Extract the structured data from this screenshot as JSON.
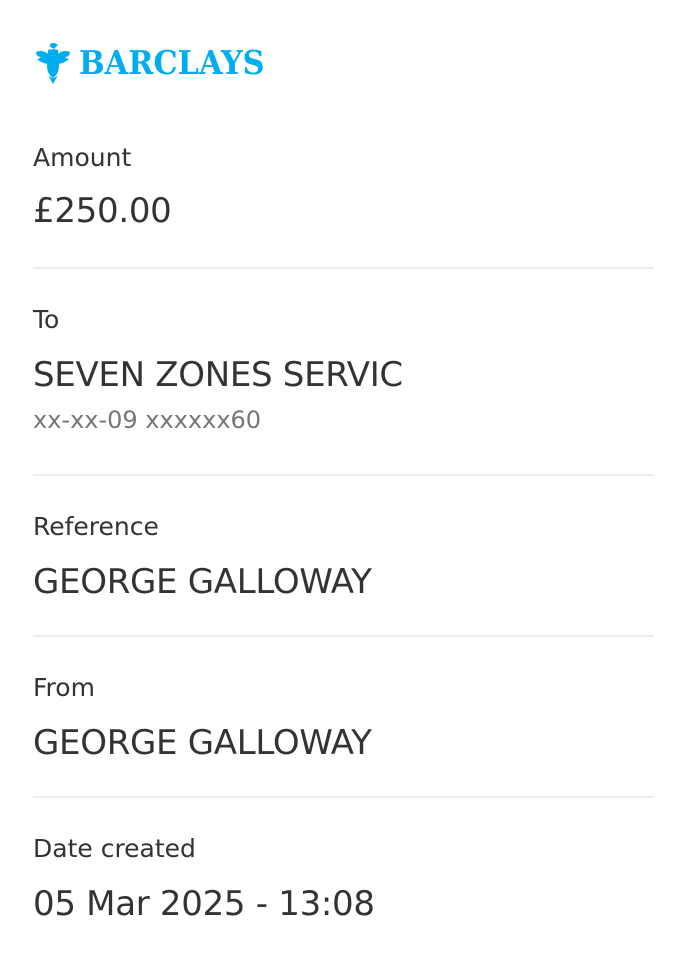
{
  "brand": {
    "name": "BARCLAYS",
    "color": "#00aeef",
    "icon": "eagle-icon"
  },
  "amount": {
    "label": "Amount",
    "value": "£250.00"
  },
  "to": {
    "label": "To",
    "value": "SEVEN ZONES SERVIC",
    "account": "xx-xx-09 xxxxxx60"
  },
  "reference": {
    "label": "Reference",
    "value": "GEORGE GALLOWAY"
  },
  "from": {
    "label": "From",
    "value": "GEORGE GALLOWAY"
  },
  "date_created": {
    "label": "Date created",
    "value": "05 Mar 2025 - 13:08"
  }
}
